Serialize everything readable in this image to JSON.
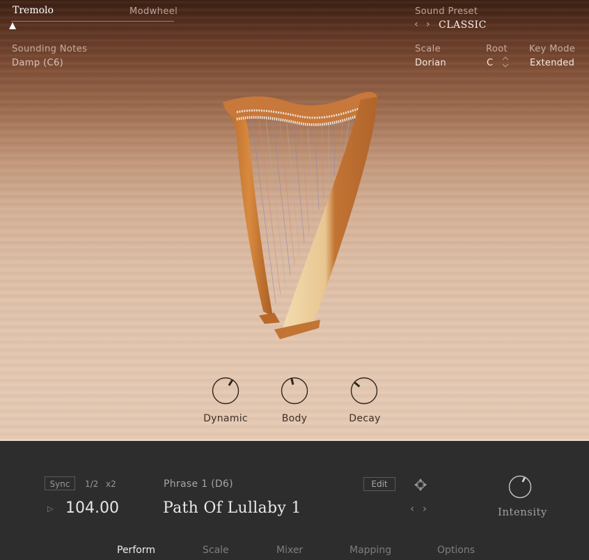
{
  "header": {
    "tremolo": {
      "label": "Tremolo",
      "source": "Modwheel",
      "value": 0
    },
    "sounding_notes": {
      "label": "Sounding Notes",
      "value": "Damp (C6)"
    },
    "sound_preset": {
      "label": "Sound Preset",
      "value": "CLASSIC",
      "prev_icon": "‹",
      "next_icon": "›"
    },
    "scale": {
      "label": "Scale",
      "value": "Dorian"
    },
    "root": {
      "label": "Root",
      "value": "C",
      "up_icon": "⌃",
      "down_icon": "⌄"
    },
    "key_mode": {
      "label": "Key Mode",
      "value": "Extended"
    }
  },
  "knobs": [
    {
      "label": "Dynamic",
      "value": 0.62
    },
    {
      "label": "Body",
      "value": 0.45
    },
    {
      "label": "Decay",
      "value": 0.32
    }
  ],
  "perform": {
    "sync_label": "Sync",
    "rate": "1/2",
    "multiplier": "x2",
    "play_icon": "▷",
    "tempo": "104.00",
    "phrase_label": "Phrase 1 (D6)",
    "phrase_name": "Path Of Lullaby 1",
    "edit_label": "Edit",
    "prev_icon": "‹",
    "next_icon": "›",
    "intensity": {
      "label": "Intensity",
      "value": 0.6
    }
  },
  "tabs": [
    {
      "label": "Perform",
      "active": true
    },
    {
      "label": "Scale",
      "active": false
    },
    {
      "label": "Mixer",
      "active": false
    },
    {
      "label": "Mapping",
      "active": false
    },
    {
      "label": "Options",
      "active": false
    }
  ],
  "colors": {
    "panel_bg": "#2d2d2d",
    "knob_stroke": "#2f2620",
    "active_tab": "#f0f0f0",
    "inactive_tab": "#7e7e7e"
  }
}
